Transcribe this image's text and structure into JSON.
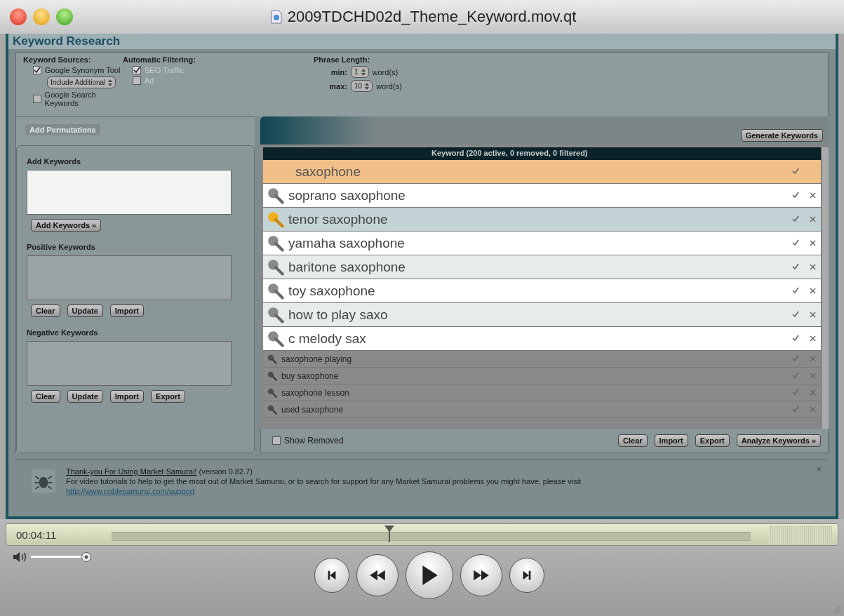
{
  "window": {
    "title": "2009TDCHD02d_Theme_Keyword.mov.qt"
  },
  "app": {
    "title": "Keyword Research",
    "sources": {
      "heading": "Keyword Sources:",
      "options": [
        {
          "label": "Google Synonym Tool",
          "checked": true
        },
        {
          "label": "Google Search Keywords",
          "checked": false
        }
      ],
      "dropdown": "Include Additional"
    },
    "filtering": {
      "heading": "Automatic Filtering:",
      "options": [
        {
          "label": "SEO Traffic",
          "checked": true
        },
        {
          "label": "Ad",
          "checked": false
        }
      ]
    },
    "phrase_length": {
      "heading": "Phrase Length:",
      "fields": [
        {
          "label": "min:",
          "value": "1",
          "unit": "word(s)"
        },
        {
          "label": "max:",
          "value": "10",
          "unit": "word(s)"
        }
      ]
    },
    "left_panel": {
      "permutations_button": {
        "label": "Add Permutations",
        "disabled": true
      },
      "sections": [
        {
          "heading": "Add Keywords",
          "buttons": [
            "Add Keywords »"
          ]
        },
        {
          "heading": "Positive Keywords",
          "buttons": [
            "Clear",
            "Update",
            "Import"
          ]
        },
        {
          "heading": "Negative Keywords",
          "buttons": [
            "Clear",
            "Update",
            "Import",
            "Export"
          ]
        }
      ]
    },
    "right_panel": {
      "generate_button": "Generate Keywords",
      "header": "Keyword (200 active, 0 removed, 0 filtered)",
      "rows": [
        {
          "text": "saxophone",
          "selected": true,
          "highlighted": false,
          "magnified": true
        },
        {
          "text": "soprano saxophone",
          "selected": false,
          "highlighted": false,
          "magnified": true
        },
        {
          "text": "tenor saxophone",
          "selected": false,
          "highlighted": true,
          "magnified": true
        },
        {
          "text": "yamaha saxophone",
          "selected": false,
          "highlighted": false,
          "magnified": true
        },
        {
          "text": "baritone saxophone",
          "selected": false,
          "highlighted": false,
          "magnified": true
        },
        {
          "text": "toy saxophone",
          "selected": false,
          "highlighted": false,
          "magnified": true
        },
        {
          "text": "how to play saxo",
          "selected": false,
          "highlighted": false,
          "magnified": true
        },
        {
          "text": "c melody sax",
          "selected": false,
          "highlighted": false,
          "magnified": true
        },
        {
          "text": "saxophone playing",
          "selected": false,
          "highlighted": false,
          "magnified": false
        },
        {
          "text": "buy saxophone",
          "selected": false,
          "highlighted": false,
          "magnified": false
        },
        {
          "text": "saxophone lesson",
          "selected": false,
          "highlighted": false,
          "magnified": false
        },
        {
          "text": "used saxophone",
          "selected": false,
          "highlighted": false,
          "magnified": false
        }
      ],
      "show_removed": {
        "label": "Show Removed",
        "checked": false
      },
      "buttons": [
        "Clear",
        "Import",
        "Export",
        "Analyze Keywords »"
      ]
    },
    "notice": {
      "link": "Thank-you For Using Market Samurai!",
      "version": "(version 0.82.7)",
      "text": "For video tutorials to help to get the most out of Market Samurai, or to search for support for any Market Samurai problems you might have, please visit",
      "url": "http://www.noblesamurai.com/support",
      "close": "×"
    }
  },
  "player": {
    "time": "00:04:11",
    "position": {
      "level": 0.435
    },
    "volume": {
      "level": 1
    }
  }
}
